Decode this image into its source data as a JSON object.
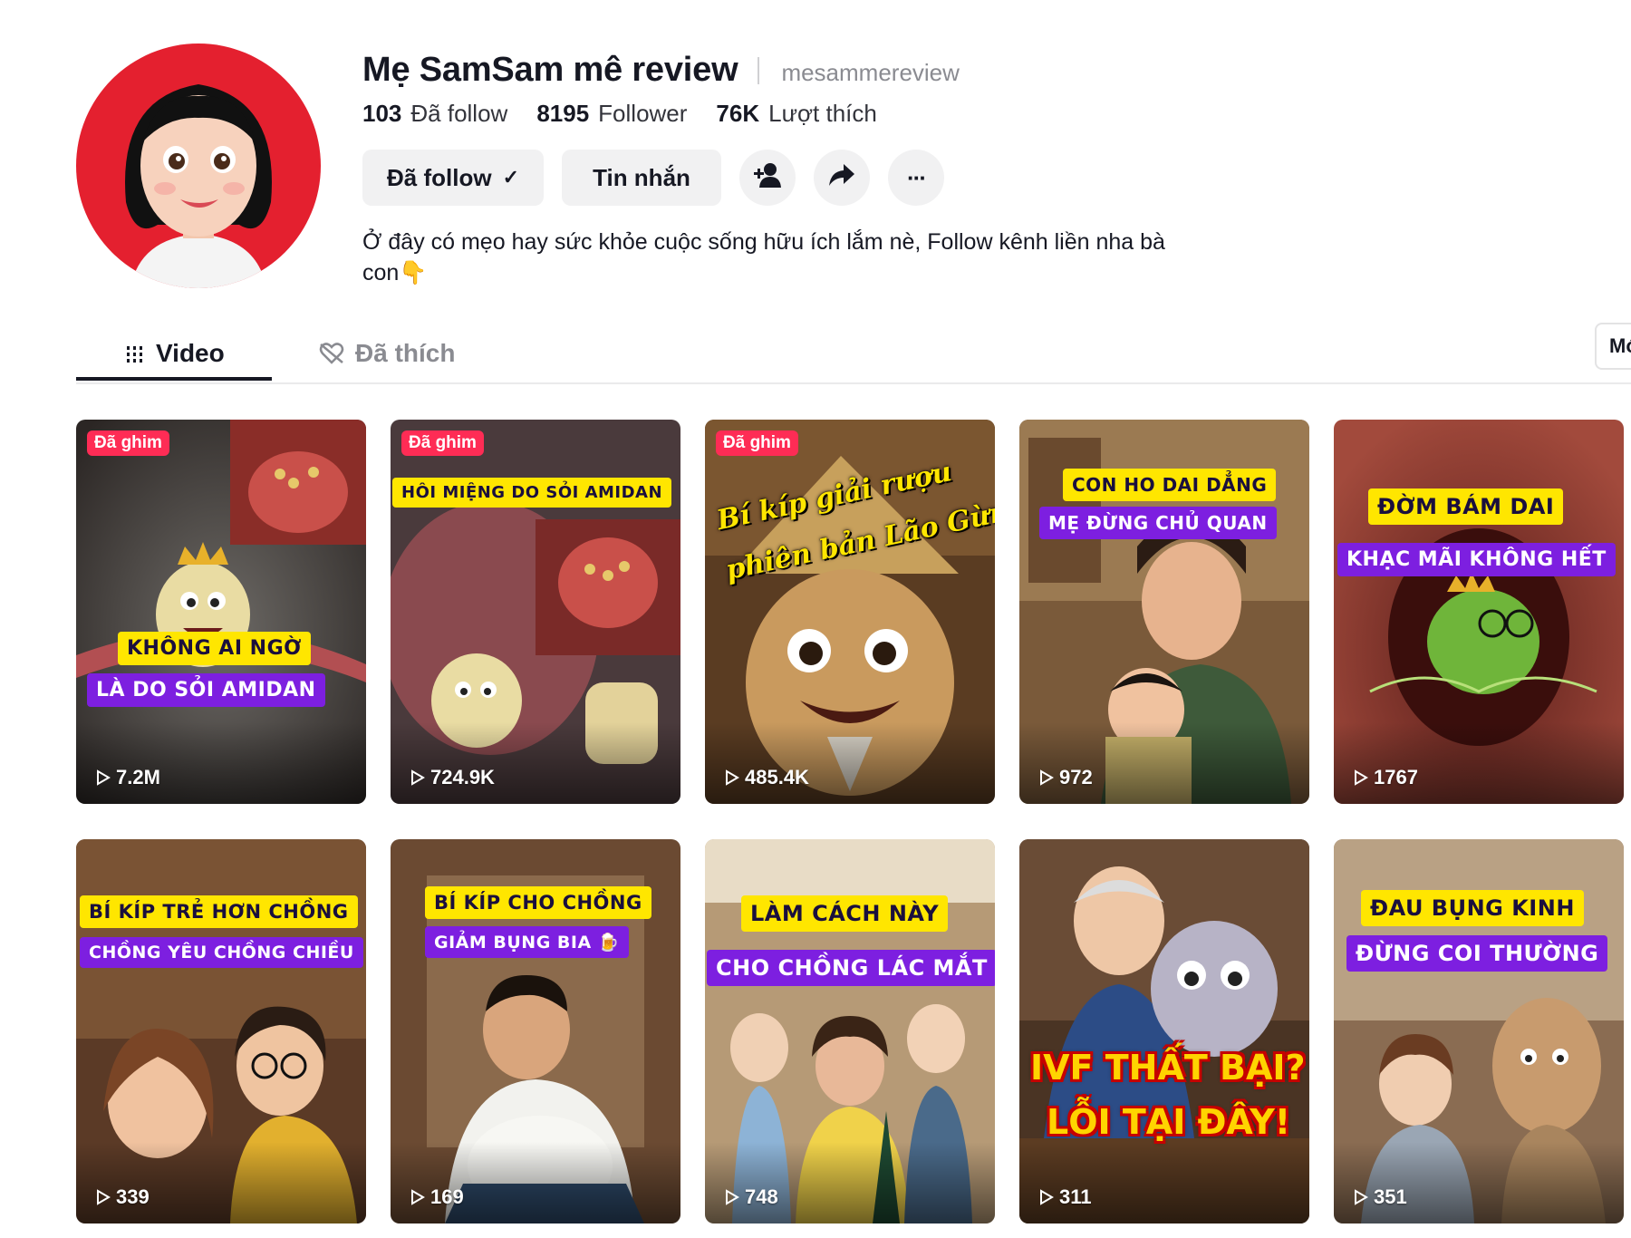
{
  "profile": {
    "name": "Mẹ SamSam mê review",
    "handle": "mesammereview",
    "stats": [
      {
        "value": "103",
        "label": "Đã follow"
      },
      {
        "value": "8195",
        "label": "Follower"
      },
      {
        "value": "76K",
        "label": "Lượt thích"
      }
    ],
    "bio": "Ở đây có mẹo hay sức khỏe cuộc sống hữu ích lắm nè, Follow kênh liền nha bà con👇"
  },
  "actions": {
    "following_label": "Đã follow",
    "following_check": "✓",
    "message_label": "Tin nhắn",
    "more_label": "···"
  },
  "tabs": [
    {
      "label": "Video",
      "icon": "grid-icon",
      "active": true
    },
    {
      "label": "Đã thích",
      "icon": "heart-hidden-icon",
      "active": false
    }
  ],
  "sort_button_label": "Mới",
  "pinned_label": "Đã ghim",
  "colors": {
    "accent": "#fe2c55",
    "caption_yellow": "#ffe600",
    "caption_purple": "#7d1fe0"
  },
  "videos": [
    {
      "pinned": true,
      "views": "7.2M",
      "captions": [
        "KHÔNG AI NGỜ",
        "LÀ DO SỎI AMIDAN"
      ]
    },
    {
      "pinned": true,
      "views": "724.9K",
      "captions": [
        "HÔI MIỆNG DO SỎI AMIDAN"
      ]
    },
    {
      "pinned": true,
      "views": "485.4K",
      "captions": [
        "Bí kíp giải rượu",
        "phiên bản Lão Gừng"
      ]
    },
    {
      "pinned": false,
      "views": "972",
      "captions": [
        "CON HO DAI DẲNG",
        "MẸ ĐỪNG CHỦ QUAN"
      ]
    },
    {
      "pinned": false,
      "views": "1767",
      "captions": [
        "ĐỜM BÁM DAI",
        "KHẠC MÃI KHÔNG HẾT"
      ]
    },
    {
      "pinned": false,
      "views": "339",
      "captions": [
        "BÍ KÍP TRẺ HƠN CHỒNG",
        "CHỒNG YÊU CHỒNG CHIỀU"
      ]
    },
    {
      "pinned": false,
      "views": "169",
      "captions": [
        "BÍ KÍP CHO CHỒNG",
        "GIẢM BỤNG BIA 🍺"
      ]
    },
    {
      "pinned": false,
      "views": "748",
      "captions": [
        "LÀM CÁCH NÀY",
        "CHO CHỒNG LÁC MẮT"
      ]
    },
    {
      "pinned": false,
      "views": "311",
      "captions": [
        "IVF THẤT BẠI?",
        "LỖI TẠI ĐÂY!"
      ]
    },
    {
      "pinned": false,
      "views": "351",
      "captions": [
        "ĐAU BỤNG KINH",
        "ĐỪNG COI THƯỜNG"
      ]
    }
  ]
}
